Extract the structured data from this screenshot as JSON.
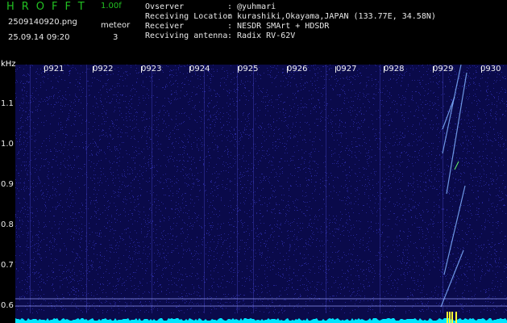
{
  "header": {
    "app_title": "HROFFT",
    "version": "1.00f",
    "filename": "2509140920.png",
    "meteor_label": "meteor",
    "timestamp": "25.09.14 09:20",
    "meteor_count": "3"
  },
  "info": {
    "observer_label": "Ovserver",
    "observer_value": ": @yuhmari",
    "location_label": "Receiving Location",
    "location_value": ": kurashiki,Okayama,JAPAN (133.77E, 34.58N)",
    "receiver_label": "Receiver",
    "receiver_value": ": NESDR SMArt + HDSDR",
    "antenna_label": "Recviving antenna",
    "antenna_value": ": Radix RV-62V"
  },
  "axis": {
    "unit": "kHz",
    "y_ticks": [
      "1.1",
      "1.0",
      "0.9",
      "0.8",
      "0.7",
      "0.6"
    ],
    "time_ticks": [
      "0921",
      "0922",
      "0923",
      "0924",
      "0925",
      "0926",
      "0927",
      "0928",
      "0929",
      "0930"
    ]
  },
  "colors": {
    "background": "#000000",
    "spectrogram_bg": "#0a0a4a",
    "noise": "#3a3acc",
    "meteor": "#7fb0ff",
    "baseline": "#00e6ff",
    "title": "#22c122"
  }
}
